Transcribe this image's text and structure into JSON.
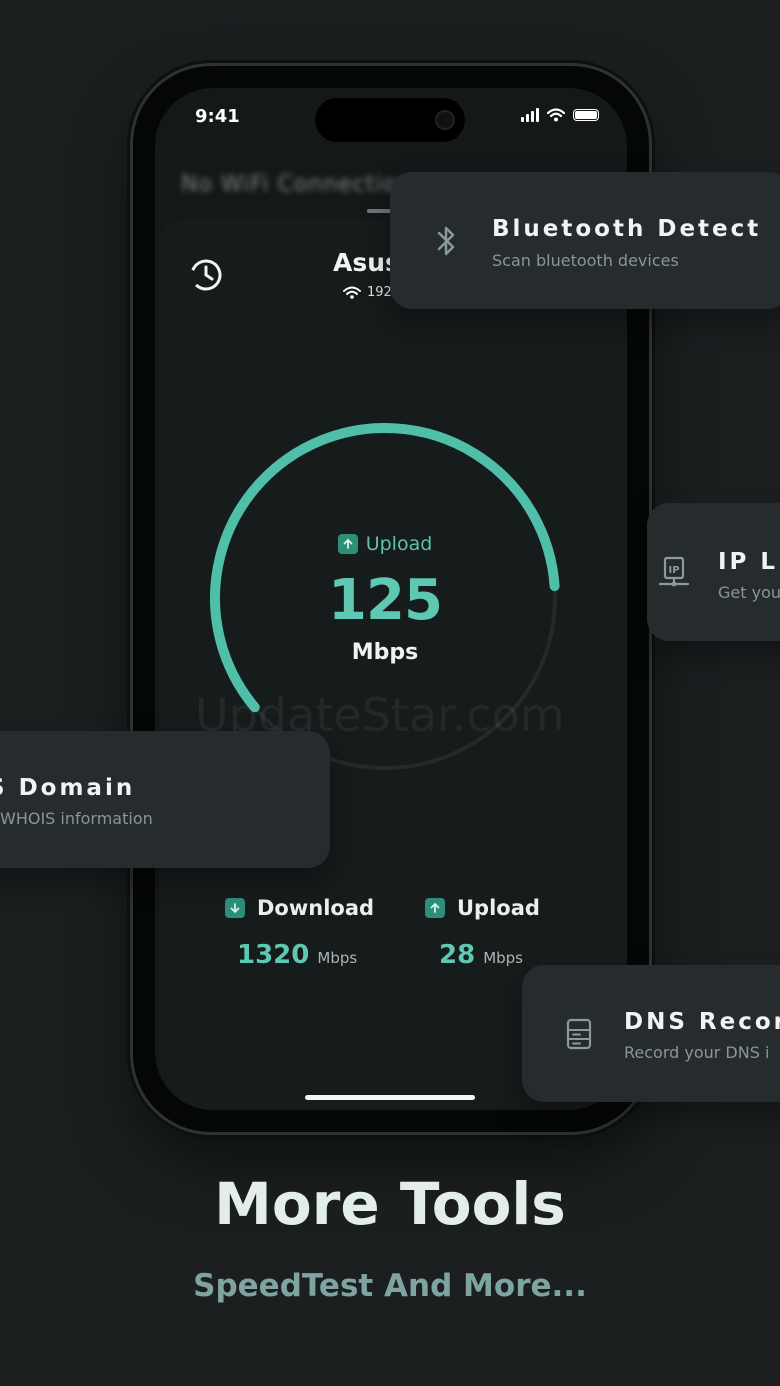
{
  "phone": {
    "status_time": "9:41",
    "blurred_header": "No WiFi Connection",
    "network_name": "Asus",
    "network_ip": "192",
    "gauge": {
      "label": "Upload",
      "value": "125",
      "unit": "Mbps",
      "progress_fraction": 0.6
    },
    "stats": [
      {
        "label": "Download",
        "value": "1320",
        "unit": "Mbps"
      },
      {
        "label": "Upload",
        "value": "28",
        "unit": "Mbps"
      }
    ],
    "watermark": "UpdateStar.com"
  },
  "tools": {
    "bluetooth": {
      "title": "Bluetooth Detect",
      "subtitle": "Scan bluetooth devices",
      "icon": "bluetooth-icon"
    },
    "ip": {
      "title": "IP L",
      "subtitle": "Get you",
      "icon": "ip-icon"
    },
    "domain": {
      "title": "S Domain",
      "subtitle": "WHOIS information"
    },
    "dns": {
      "title": "DNS Recor",
      "subtitle": "Record your DNS i",
      "icon": "dns-icon"
    }
  },
  "footer": {
    "title": "More Tools",
    "subtitle": "SpeedTest And More..."
  },
  "colors": {
    "accent": "#5ec8b2",
    "background": "#1b1f20",
    "card": "#262c2e"
  }
}
